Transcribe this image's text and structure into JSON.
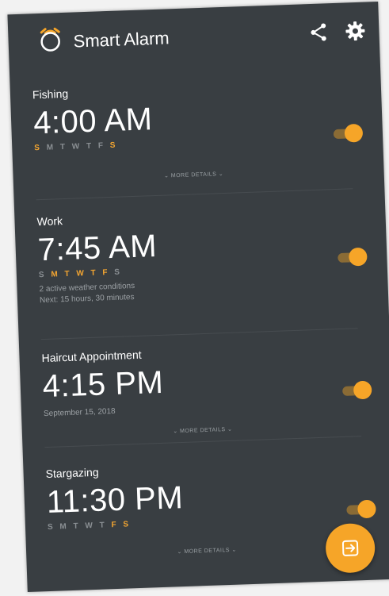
{
  "app": {
    "title": "Smart Alarm",
    "accent_color": "#f6a528",
    "background_color": "#393e42"
  },
  "toolbar": {
    "share_icon": "share-icon",
    "settings_icon": "gear-icon"
  },
  "alarms": [
    {
      "name": "Fishing",
      "time": "4:00 AM",
      "days": [
        {
          "letter": "S",
          "active": true
        },
        {
          "letter": "M",
          "active": false
        },
        {
          "letter": "T",
          "active": false
        },
        {
          "letter": "W",
          "active": false
        },
        {
          "letter": "T",
          "active": false
        },
        {
          "letter": "F",
          "active": false
        },
        {
          "letter": "S",
          "active": true
        }
      ],
      "enabled": true,
      "more_details": "⌄ MORE DETAILS ⌄"
    },
    {
      "name": "Work",
      "time": "7:45 AM",
      "days": [
        {
          "letter": "S",
          "active": false
        },
        {
          "letter": "M",
          "active": true
        },
        {
          "letter": "T",
          "active": true
        },
        {
          "letter": "W",
          "active": true
        },
        {
          "letter": "T",
          "active": true
        },
        {
          "letter": "F",
          "active": true
        },
        {
          "letter": "S",
          "active": false
        }
      ],
      "details_line1": "2 active weather conditions",
      "details_line2": "Next: 15 hours, 30 minutes",
      "enabled": true
    },
    {
      "name": "Haircut Appointment",
      "time": "4:15 PM",
      "date": "September 15, 2018",
      "enabled": true,
      "more_details": "⌄ MORE DETAILS ⌄"
    },
    {
      "name": "Stargazing",
      "time": "11:30 PM",
      "days": [
        {
          "letter": "S",
          "active": false
        },
        {
          "letter": "M",
          "active": false
        },
        {
          "letter": "T",
          "active": false
        },
        {
          "letter": "W",
          "active": false
        },
        {
          "letter": "T",
          "active": false
        },
        {
          "letter": "F",
          "active": true
        },
        {
          "letter": "S",
          "active": true
        }
      ],
      "enabled": true,
      "more_details": "⌄ MORE DETAILS ⌄"
    }
  ],
  "fab": {
    "icon": "add-alarm-icon"
  }
}
